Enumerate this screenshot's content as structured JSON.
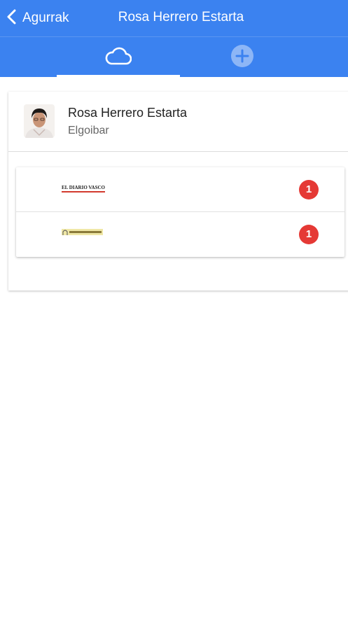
{
  "header": {
    "back_label": "Agurrak",
    "title": "Rosa Herrero Estarta"
  },
  "tabs": [
    {
      "icon": "cloud-icon",
      "active": true
    },
    {
      "icon": "plus-circle-icon",
      "active": false
    }
  ],
  "profile": {
    "name": "Rosa Herrero Estarta",
    "place": "Elgoibar"
  },
  "sources": [
    {
      "logo_text": "EL DIARIO VASCO",
      "count": "1"
    },
    {
      "logo_text": "",
      "count": "1"
    }
  ],
  "colors": {
    "primary": "#3b82f0",
    "badge": "#e53935"
  }
}
